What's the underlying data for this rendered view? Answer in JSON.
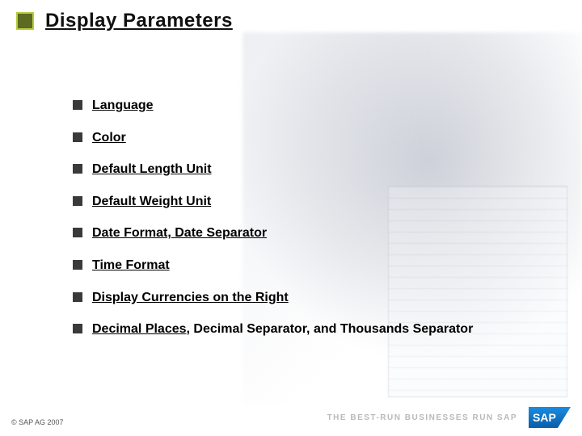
{
  "title": "Display Parameters",
  "bullets": [
    {
      "segments": [
        {
          "text": "Language",
          "underline": true
        }
      ]
    },
    {
      "segments": [
        {
          "text": "Color",
          "underline": true
        }
      ]
    },
    {
      "segments": [
        {
          "text": "Default Length Unit",
          "underline": true
        }
      ]
    },
    {
      "segments": [
        {
          "text": "Default Weight Unit",
          "underline": true
        }
      ]
    },
    {
      "segments": [
        {
          "text": "Date Format, Date Separator",
          "underline": true
        }
      ]
    },
    {
      "segments": [
        {
          "text": "Time Format",
          "underline": true
        }
      ]
    },
    {
      "segments": [
        {
          "text": "Display Currencies on the Right",
          "underline": true
        }
      ]
    },
    {
      "segments": [
        {
          "text": "Decimal Places",
          "underline": true
        },
        {
          "text": ", Decimal Separator, and Thousands Separator",
          "underline": false
        }
      ]
    }
  ],
  "copyright": "© SAP AG 2007",
  "tagline": "THE BEST-RUN BUSINESSES RUN SAP",
  "logo_text": "SAP"
}
